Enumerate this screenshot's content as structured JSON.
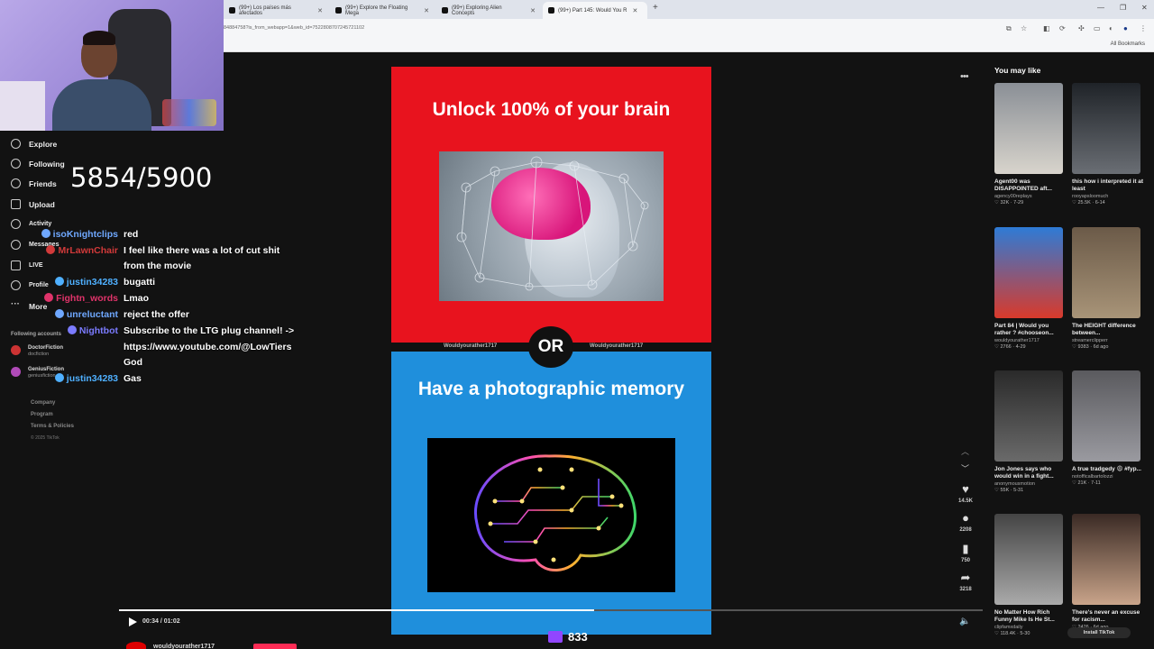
{
  "browser": {
    "tabs": [
      {
        "label": "(99+) Los países más afectados",
        "active": false
      },
      {
        "label": "(99+) Explore the Floating Mega",
        "active": false
      },
      {
        "label": "(99+) Exploring Alien Concepts",
        "active": false
      },
      {
        "label": "(99+) Part 145: Would You R",
        "active": true
      }
    ],
    "url": "84884758?is_from_webapp=1&web_id=7522808707245721102",
    "all_bookmarks": "All Bookmarks"
  },
  "overlay": {
    "counter": "5854/5900",
    "viewer_count": "833"
  },
  "chat": [
    {
      "user": "isoKnightclips",
      "color": "#6fa8ff",
      "msg": "red"
    },
    {
      "user": "MrLawnChair",
      "color": "#d23a3a",
      "msg": "I feel like there was a lot of cut shit"
    },
    {
      "user": "",
      "color": "",
      "msg": "from the movie"
    },
    {
      "user": "justin34283",
      "color": "#4fb0ff",
      "msg": "bugatti"
    },
    {
      "user": "Fightn_words",
      "color": "#e0336a",
      "msg": "Lmao"
    },
    {
      "user": "unreluctant",
      "color": "#6fa8ff",
      "msg": "reject the offer"
    },
    {
      "user": "Nightbot",
      "color": "#7b7bff",
      "msg": "Subscribe to the LTG plug channel! ->"
    },
    {
      "user": "",
      "color": "",
      "msg": "https://www.youtube.com/@LowTiers"
    },
    {
      "user": "",
      "color": "",
      "msg": "God"
    },
    {
      "user": "justin34283",
      "color": "#4fb0ff",
      "msg": "Gas"
    }
  ],
  "sidebar": {
    "items": [
      {
        "label": "Explore"
      },
      {
        "label": "Following"
      },
      {
        "label": "Friends"
      },
      {
        "label": "Upload"
      },
      {
        "label": "Activity"
      },
      {
        "label": "Messages"
      },
      {
        "label": "LIVE"
      },
      {
        "label": "Profile"
      },
      {
        "label": "More"
      }
    ],
    "following_header": "Following accounts",
    "accounts": [
      {
        "name": "DoctorFiction",
        "handle": "docfiction"
      },
      {
        "name": "GeniusFiction",
        "handle": "geniusfiction"
      }
    ],
    "footer": [
      "Company",
      "Program",
      "Terms & Policies"
    ],
    "copyright": "© 2025 TikTok"
  },
  "video": {
    "top_text": "Unlock 100% of your brain",
    "or_label": "OR",
    "bottom_text": "Have a photographic memory",
    "watermark": "Wouldyourather1717",
    "time": "00:34 / 01:02",
    "progress": 0.55,
    "author": "wouldyourather1717"
  },
  "actions": [
    {
      "icon": "heart-icon",
      "glyph": "♥",
      "count": "14.5K"
    },
    {
      "icon": "comment-icon",
      "glyph": "●",
      "count": "2208"
    },
    {
      "icon": "bookmark-icon",
      "glyph": "▮",
      "count": "750"
    },
    {
      "icon": "share-icon",
      "glyph": "➦",
      "count": "3218"
    }
  ],
  "you_may_like": {
    "title": "You may like",
    "cards": [
      {
        "title": "Agent00 was DISAPPOINTED aft...",
        "author": "agency00replays",
        "stats": "♡ 32K · 7-29",
        "c1": "#8a8f96",
        "c2": "#d8d4cc"
      },
      {
        "title": "this how i interpreted it at least",
        "author": "rooyapsloomuch",
        "stats": "♡ 25.5K · 6-14",
        "c1": "#1f2328",
        "c2": "#6a6e74"
      },
      {
        "title": "Part 84 | Would you rather ? #chooseon...",
        "author": "wouldyourather1717",
        "stats": "♡ 2766 · 4-29",
        "c1": "#2e7bd6",
        "c2": "#d93a2b"
      },
      {
        "title": "The HEIGHT difference between...",
        "author": "streamerclipperr",
        "stats": "♡ 9383 · 6d ago",
        "c1": "#6b5a48",
        "c2": "#a89478"
      },
      {
        "title": "Jon Jones says who would win in a fight...",
        "author": "anonymousmotion",
        "stats": "♡ 55K · 5-31",
        "c1": "#2a2a2a",
        "c2": "#6a6a6a"
      },
      {
        "title": "A true tradgedy 😩 #fyp...",
        "author": "notofficalbartolozzi",
        "stats": "♡ 21K · 7-11",
        "c1": "#5a5a5e",
        "c2": "#9a9aa0"
      },
      {
        "title": "No Matter How Rich Funny Mike Is He St...",
        "author": "clipfamxdaily",
        "stats": "♡ 118.4K · 5-30",
        "c1": "#444",
        "c2": "#aaa"
      },
      {
        "title": "There's never an excuse for racism...",
        "author": "",
        "stats": "♡ 2426 · 6d ago",
        "c1": "#3a2a24",
        "c2": "#c9a48a"
      }
    ]
  },
  "install_label": "Install TikTok"
}
